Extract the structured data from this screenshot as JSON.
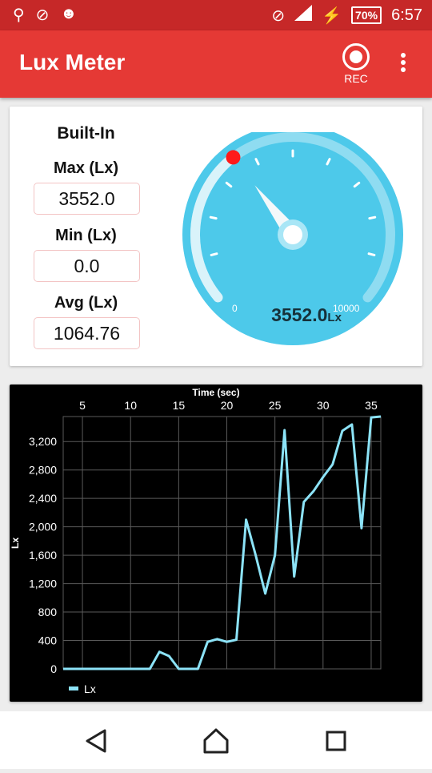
{
  "status_bar": {
    "icons": [
      "usb-icon",
      "no-location-icon",
      "android-icon",
      "do-not-disturb-icon",
      "signal-icon",
      "charging-icon"
    ],
    "battery": "70%",
    "time": "6:57"
  },
  "app_bar": {
    "title": "Lux Meter",
    "rec_label": "REC"
  },
  "sensor": {
    "title": "Built-In",
    "max_label": "Max (Lx)",
    "max_value": "3552.0",
    "min_label": "Min (Lx)",
    "min_value": "0.0",
    "avg_label": "Avg (Lx)",
    "avg_value": "1064.76"
  },
  "gauge": {
    "value": 3552.0,
    "value_text": "3552.0",
    "unit": "Lx",
    "min_label": "0",
    "max_label": "10000",
    "min": 0,
    "max": 10000,
    "colors": {
      "face": "#4dc9ea",
      "track": "#8fdcf1",
      "needle": "#f3f8fa",
      "marker": "#ff1a1a"
    }
  },
  "chart_data": {
    "type": "line",
    "xlabel": "Time (sec)",
    "ylabel": "Lx",
    "x_ticks": [
      "5",
      "10",
      "15",
      "20",
      "25",
      "30",
      "35"
    ],
    "y_ticks": [
      "0",
      "400",
      "800",
      "1,200",
      "1,600",
      "2,000",
      "2,400",
      "2,800",
      "3,200"
    ],
    "xlim": [
      3,
      36
    ],
    "ylim": [
      0,
      3552
    ],
    "grid": true,
    "legend_position": "bottom-left",
    "series": [
      {
        "name": "Lx",
        "color": "#8ce3f7",
        "x": [
          3,
          4,
          5,
          6,
          7,
          8,
          9,
          10,
          11,
          12,
          13,
          14,
          15,
          16,
          17,
          18,
          19,
          20,
          21,
          22,
          23,
          24,
          25,
          26,
          27,
          28,
          29,
          30,
          31,
          32,
          33,
          34,
          35,
          36
        ],
        "y": [
          0,
          0,
          0,
          0,
          0,
          0,
          0,
          0,
          0,
          0,
          240,
          180,
          0,
          0,
          0,
          380,
          420,
          380,
          410,
          2100,
          1600,
          1060,
          1600,
          3360,
          1300,
          2350,
          2500,
          2700,
          2880,
          3350,
          3440,
          1980,
          3540,
          3552
        ]
      }
    ]
  },
  "nav": {
    "icons": [
      "back-icon",
      "home-icon",
      "recents-icon"
    ]
  }
}
